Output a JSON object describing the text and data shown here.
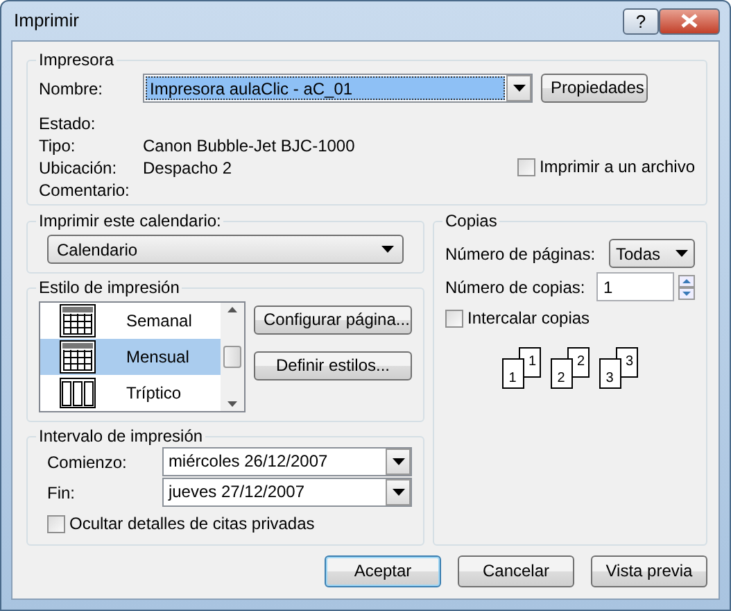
{
  "window": {
    "title": "Imprimir",
    "help_button": "?"
  },
  "printer": {
    "legend": "Impresora",
    "name_label": "Nombre:",
    "name_value": "Impresora aulaClic - aC_01",
    "properties_button": "Propiedades",
    "status_label": "Estado:",
    "type_label": "Tipo:",
    "type_value": "Canon Bubble-Jet BJC-1000",
    "location_label": "Ubicación:",
    "location_value": "Despacho 2",
    "comment_label": "Comentario:",
    "print_to_file": {
      "label": "Imprimir a un archivo",
      "checked": false
    }
  },
  "calendar": {
    "legend": "Imprimir este calendario:",
    "value": "Calendario"
  },
  "print_style": {
    "legend": "Estilo de impresión",
    "items": [
      {
        "label": "Semanal",
        "kind": "grid",
        "selected": false
      },
      {
        "label": "Mensual",
        "kind": "grid",
        "selected": true
      },
      {
        "label": "Tríptico",
        "kind": "columns",
        "selected": false
      }
    ],
    "buttons": [
      "Configurar página...",
      "Definir estilos..."
    ]
  },
  "range": {
    "legend": "Intervalo de impresión",
    "start_label": "Comienzo:",
    "start_value": "miércoles 26/12/2007",
    "end_label": "Fin:",
    "end_value": "jueves 27/12/2007",
    "hide_private": {
      "label": "Ocultar detalles de citas privadas",
      "checked": false
    }
  },
  "copies": {
    "legend": "Copias",
    "pages_label": "Número de páginas:",
    "pages_value": "Todas",
    "copies_label": "Número de copias:",
    "copies_value": "1",
    "collate": {
      "label": "Intercalar copias",
      "checked": false
    },
    "collate_sets": [
      {
        "back": "1",
        "front": "1"
      },
      {
        "back": "2",
        "front": "2"
      },
      {
        "back": "3",
        "front": "3"
      }
    ]
  },
  "buttons": [
    {
      "label": "Aceptar",
      "default": true
    },
    {
      "label": "Cancelar",
      "default": false
    },
    {
      "label": "Vista previa",
      "default": false
    }
  ]
}
